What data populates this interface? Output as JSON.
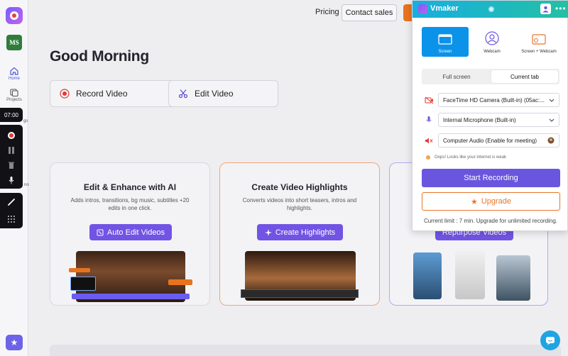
{
  "sidebar": {
    "workspace_initials": "MS",
    "nav": [
      {
        "label": "Home",
        "icon": "home-icon"
      },
      {
        "label": "Projects",
        "icon": "folder-icon"
      }
    ],
    "timer": "07:00",
    "partial_labels": [
      "gs",
      "no"
    ]
  },
  "topbar": {
    "pricing": "Pricing",
    "contact": "Contact sales"
  },
  "main": {
    "greeting": "Good Morning",
    "actions": [
      {
        "label": "Record Video",
        "icon": "record-icon"
      },
      {
        "label": "Edit Video",
        "icon": "scissors-icon"
      }
    ],
    "cards": [
      {
        "title": "Edit & Enhance with AI",
        "desc": "Adds intros, transitions, bg music, subtitles +20 edits in one click.",
        "cta": "Auto Edit Videos"
      },
      {
        "title": "Create Video Highlights",
        "desc": "Converts videos into short teasers, intros and highlights.",
        "cta": "Create Highlights"
      },
      {
        "title": "",
        "desc": "",
        "cta": "Repurpose Videos"
      }
    ]
  },
  "extension": {
    "title": "Vmaker",
    "modes": [
      {
        "label": "Screen",
        "icon": "screen-icon"
      },
      {
        "label": "Webcam",
        "icon": "webcam-icon"
      },
      {
        "label": "Screen + Webcam",
        "icon": "screen-webcam-icon"
      }
    ],
    "tabs": [
      "Full screen",
      "Current tab"
    ],
    "camera": "FaceTime HD Camera (Built-in) (05ac:...",
    "microphone": "Internal Microphone (Built-in)",
    "audio": "Computer Audio (Enable for meeting)",
    "warning": "Oops! Looks like your internet is weak",
    "start": "Start Recording",
    "upgrade": "Upgrade",
    "limit": "Current limit : 7 min.  Upgrade for unlimited recording."
  },
  "colors": {
    "accent": "#6a55de",
    "brand_blue": "#0b93ea",
    "upgrade_orange": "#e8762a",
    "record_red": "#e53935"
  }
}
